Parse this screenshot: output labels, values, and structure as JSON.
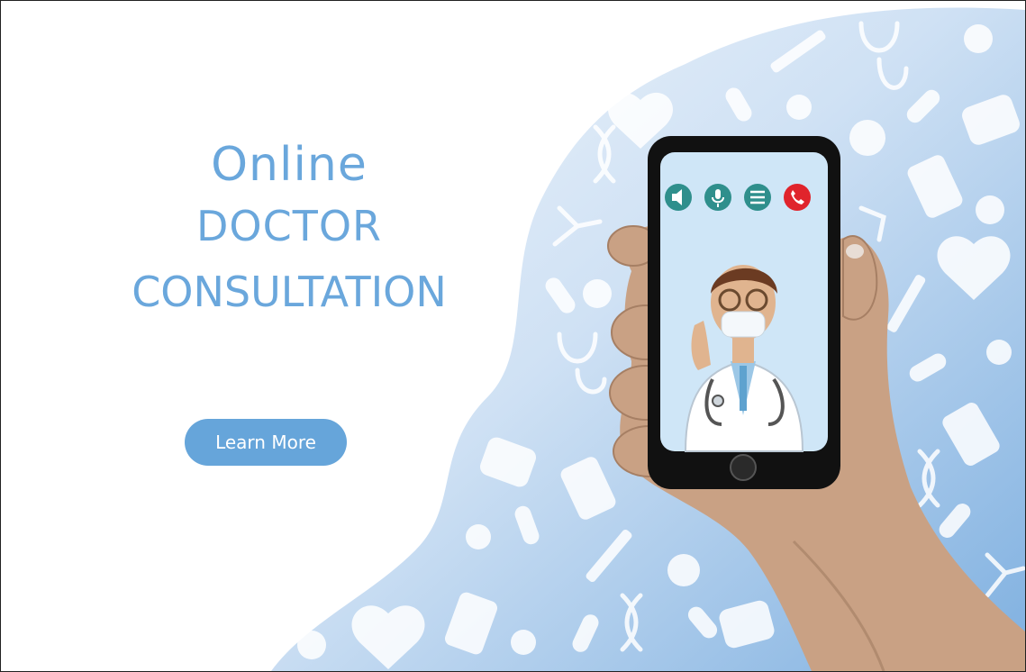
{
  "hero": {
    "line1": "Online",
    "line2": "DOCTOR",
    "line3": "CONSULTATION"
  },
  "cta": {
    "label": "Learn More"
  },
  "phone": {
    "call_controls": [
      {
        "icon": "speaker-icon",
        "color": "#2f8f8c"
      },
      {
        "icon": "microphone-icon",
        "color": "#2f8f8c"
      },
      {
        "icon": "menu-icon",
        "color": "#2f8f8c"
      },
      {
        "icon": "phone-hangup-icon",
        "color": "#e0242c"
      }
    ]
  },
  "colors": {
    "accent": "#6aa7dc",
    "button": "#66a5da",
    "blob_light": "#e6f0fa",
    "blob_dark": "#8bb6e3",
    "skin": "#c9a184",
    "phone_body": "#111111",
    "screen": "#cfe6f7"
  }
}
